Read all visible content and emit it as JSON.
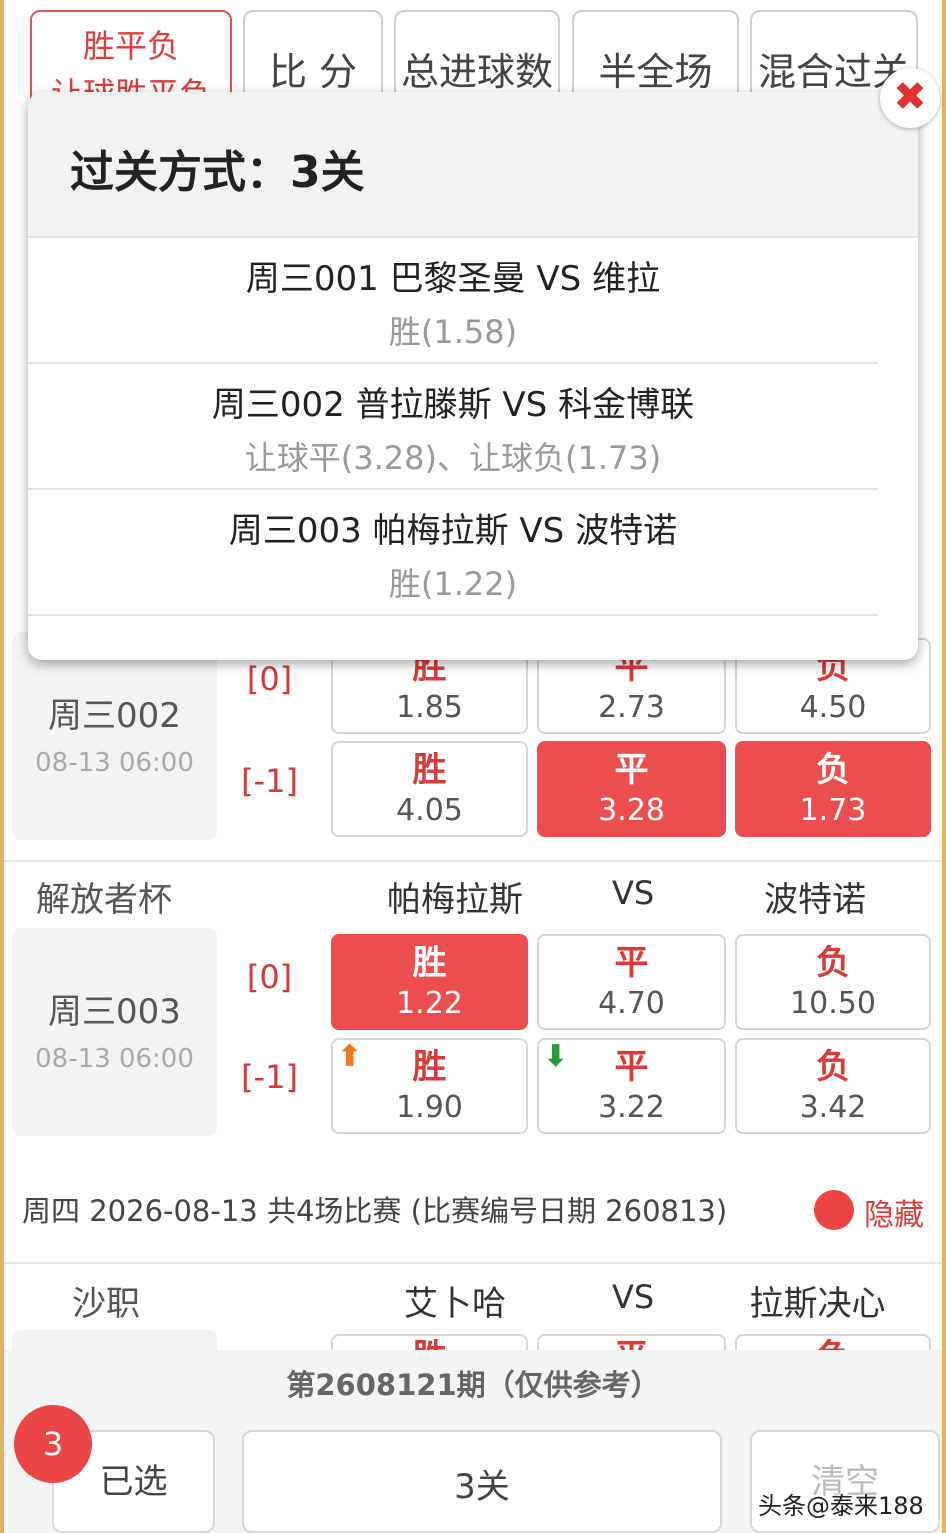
{
  "tabs": [
    {
      "label_line1": "胜平负",
      "label_line2": "让球胜平负",
      "active": true
    },
    {
      "label": "比 分"
    },
    {
      "label": "总进球数"
    },
    {
      "label": "半全场"
    },
    {
      "label": "混合过关"
    }
  ],
  "matches": [
    {
      "code": "周三002",
      "time": "08-13 06:00",
      "rows": [
        {
          "handicap": "[0]",
          "options": [
            {
              "name": "胜",
              "odds": "1.85",
              "selected": false
            },
            {
              "name": "平",
              "odds": "2.73",
              "selected": false
            },
            {
              "name": "负",
              "odds": "4.50",
              "selected": false
            }
          ]
        },
        {
          "handicap": "[-1]",
          "options": [
            {
              "name": "胜",
              "odds": "4.05",
              "selected": false
            },
            {
              "name": "平",
              "odds": "3.28",
              "selected": true
            },
            {
              "name": "负",
              "odds": "1.73",
              "selected": true
            }
          ]
        }
      ]
    },
    {
      "league": "解放者杯",
      "home": "帕梅拉斯",
      "vs": "VS",
      "away": "波特诺",
      "code": "周三003",
      "time": "08-13 06:00",
      "rows": [
        {
          "handicap": "[0]",
          "options": [
            {
              "name": "胜",
              "odds": "1.22",
              "selected": true
            },
            {
              "name": "平",
              "odds": "4.70",
              "selected": false
            },
            {
              "name": "负",
              "odds": "10.50",
              "selected": false
            }
          ]
        },
        {
          "handicap": "[-1]",
          "options": [
            {
              "name": "胜",
              "odds": "1.90",
              "selected": false,
              "trend": "up"
            },
            {
              "name": "平",
              "odds": "3.22",
              "selected": false,
              "trend": "down"
            },
            {
              "name": "负",
              "odds": "3.42",
              "selected": false
            }
          ]
        }
      ]
    }
  ],
  "day_header": {
    "text": "周四 2026-08-13 共4场比赛 (比赛编号日期 260813)",
    "hide_label": "隐藏"
  },
  "next_match": {
    "league": "沙职",
    "home": "艾卜哈",
    "vs": "VS",
    "away": "拉斯决心",
    "partial": [
      "胜",
      "平",
      "负"
    ]
  },
  "bottom": {
    "period": "第2608121期（仅供参考）",
    "selected_label": "已选",
    "selected_count": "3",
    "pass_label": "3关",
    "clear_label": "清空",
    "watermark": "头条@泰来188"
  },
  "popup": {
    "title": "过关方式：3关",
    "close_symbol": "✖",
    "picks": [
      {
        "match": "周三001 巴黎圣曼 VS 维拉",
        "selection": "胜(1.58)"
      },
      {
        "match": "周三002 普拉滕斯 VS 科金博联",
        "selection": "让球平(3.28)、让球负(1.73)"
      },
      {
        "match": "周三003 帕梅拉斯 VS 波特诺",
        "selection": "胜(1.22)"
      }
    ]
  },
  "colors": {
    "accent": "#ec4d4d",
    "frame": "#e3b55a",
    "trend_up": "#f07a1a",
    "trend_down": "#2a9a3a"
  }
}
